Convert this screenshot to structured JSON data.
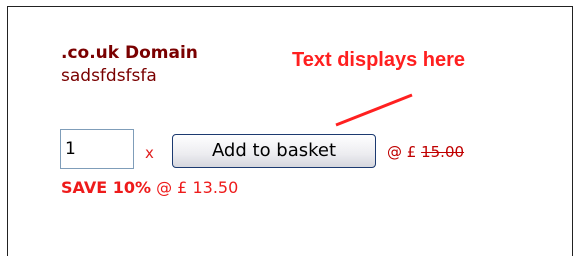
{
  "product": {
    "title": ".co.uk Domain",
    "description": "sadsfdsfsfa"
  },
  "annotation": {
    "text": "Text displays here",
    "color": "#ff2020"
  },
  "purchase": {
    "quantity": "1",
    "times_symbol": "x",
    "add_button_label": "Add to basket",
    "price_prefix": "@ £",
    "old_price": "15.00"
  },
  "discount": {
    "save_label": "SAVE 10%",
    "price_prefix": "@ £",
    "new_price": "13.50"
  },
  "colors": {
    "title": "#7a0000",
    "accent_red": "#ee1b1b"
  }
}
